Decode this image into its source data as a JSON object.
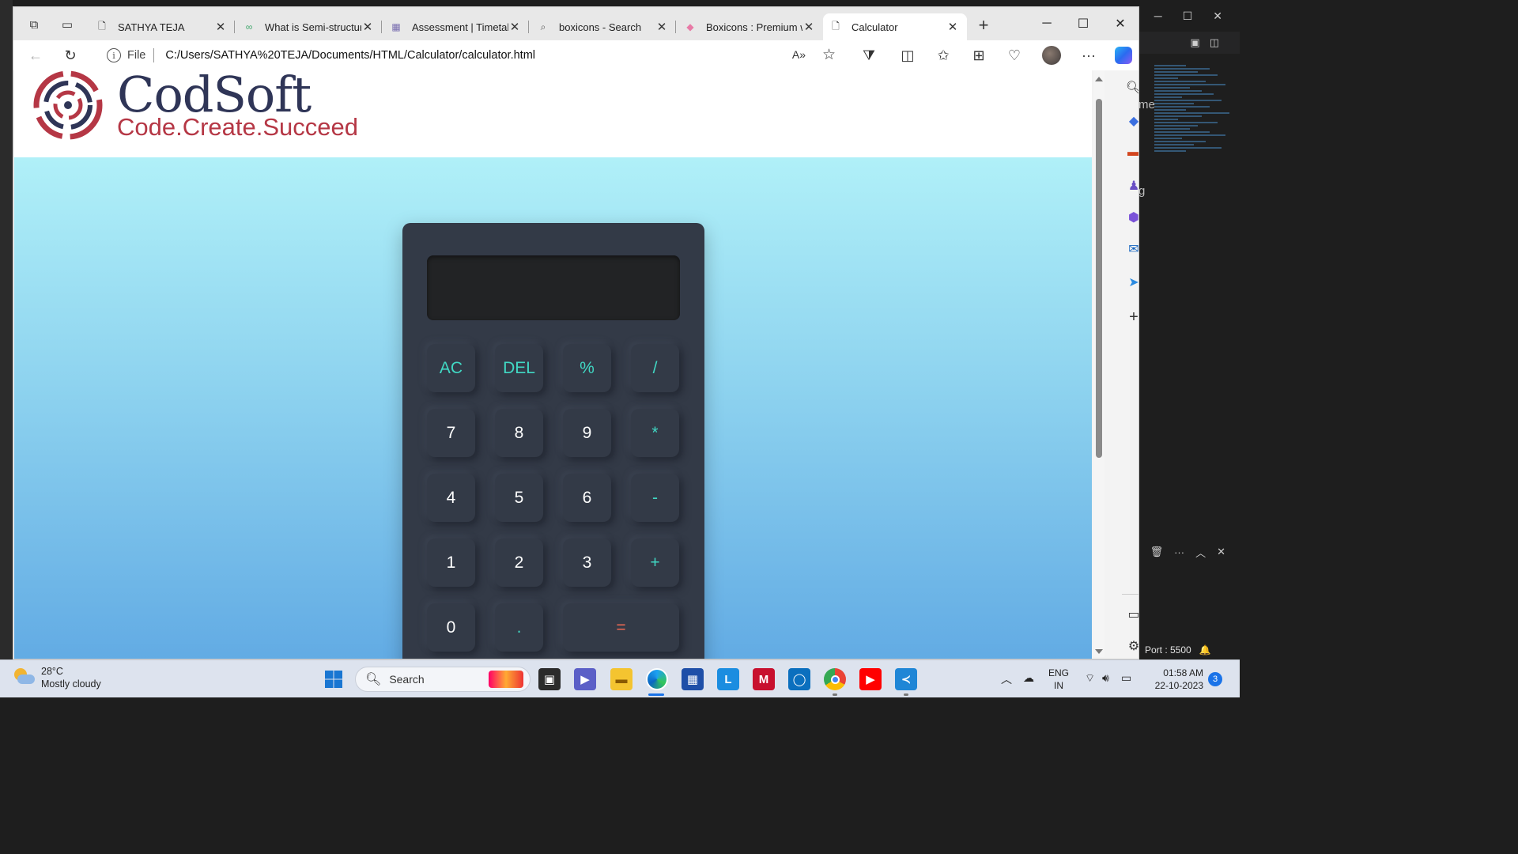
{
  "browser": {
    "tabs": [
      {
        "title": "SATHYA TEJA",
        "active": false
      },
      {
        "title": "What is Semi-structured",
        "active": false
      },
      {
        "title": "Assessment | Timetable",
        "active": false
      },
      {
        "title": "boxicons - Search",
        "active": false
      },
      {
        "title": "Boxicons : Premium w",
        "active": false
      },
      {
        "title": "Calculator",
        "active": true
      }
    ],
    "address": {
      "scheme_label": "File",
      "url": "C:/Users/SATHYA%20TEJA/Documents/HTML/Calculator/calculator.html"
    }
  },
  "page": {
    "logo": {
      "name": "CodSoft",
      "tagline": "Code.Create.Succeed",
      "colors": {
        "primary": "#2f3557",
        "accent": "#b53745"
      }
    },
    "calculator": {
      "display_value": "",
      "keys": [
        {
          "label": "AC",
          "kind": "op"
        },
        {
          "label": "DEL",
          "kind": "op"
        },
        {
          "label": "%",
          "kind": "op"
        },
        {
          "label": "/",
          "kind": "op"
        },
        {
          "label": "7",
          "kind": "digit"
        },
        {
          "label": "8",
          "kind": "digit"
        },
        {
          "label": "9",
          "kind": "digit"
        },
        {
          "label": "*",
          "kind": "op"
        },
        {
          "label": "4",
          "kind": "digit"
        },
        {
          "label": "5",
          "kind": "digit"
        },
        {
          "label": "6",
          "kind": "digit"
        },
        {
          "label": "-",
          "kind": "op"
        },
        {
          "label": "1",
          "kind": "digit"
        },
        {
          "label": "2",
          "kind": "digit"
        },
        {
          "label": "3",
          "kind": "digit"
        },
        {
          "label": "+",
          "kind": "op"
        },
        {
          "label": "0",
          "kind": "digit"
        },
        {
          "label": ".",
          "kind": "op"
        },
        {
          "label": "=",
          "kind": "equals"
        }
      ],
      "colors": {
        "body": "#333a47",
        "operator": "#41d8c4",
        "equals": "#f16a53",
        "digit": "#ffffff"
      }
    }
  },
  "vscode": {
    "side_text_1": "me",
    "side_text_2": "g",
    "status_port": "Port : 5500"
  },
  "taskbar": {
    "weather": {
      "temp": "28°C",
      "condition": "Mostly cloudy"
    },
    "search_placeholder": "Search",
    "language": {
      "line1": "ENG",
      "line2": "IN"
    },
    "clock": {
      "time": "01:58 AM",
      "date": "22-10-2023"
    },
    "notifications": "3"
  }
}
